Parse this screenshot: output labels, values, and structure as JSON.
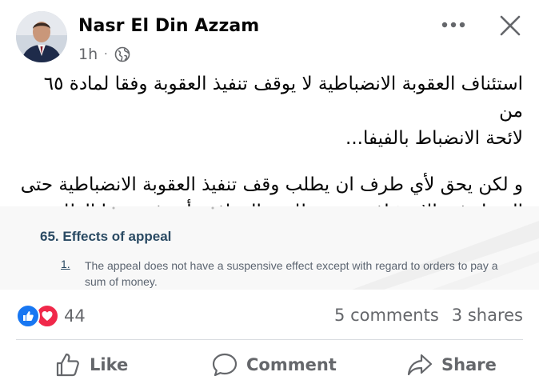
{
  "post": {
    "author": "Nasr El Din Azzam",
    "time": "1h",
    "separator": "·",
    "audience_icon": "globe-icon",
    "more_icon": "more-dots-icon",
    "close_icon": "close-icon",
    "text": {
      "paragraph1_line1": "استئناف العقوبة الانضباطية لا يوقف تنفيذ العقوبة وفقا لمادة ٦٥ من",
      "paragraph1_line2": "لائحة الانضباط بالفيفا...",
      "paragraph2_line1": "و لكن يحق لأي طرف ان يطلب وقف تنفيذ العقوبة الانضباطية حتى",
      "paragraph2_line2": "الفصل في الإستئناف و يحق للجنة الموافقة أو رفض هذا الطلب."
    },
    "attachment": {
      "heading": "65. Effects of appeal",
      "item_number": "1.",
      "item_text": "The appeal does not have a suspensive effect except with regard to orders to pay a sum of money."
    },
    "stats": {
      "reaction_count": "44",
      "comments": "5 comments",
      "shares": "3 shares"
    },
    "actions": {
      "like": "Like",
      "comment": "Comment",
      "share": "Share"
    },
    "colors": {
      "like_blue": "#1877f2",
      "love_red": "#f0284a",
      "secondary_text": "#65676b",
      "heading_blue": "#2a4a63"
    }
  }
}
